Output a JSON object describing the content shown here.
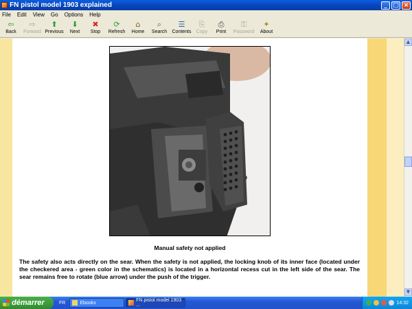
{
  "window": {
    "title": "FN pistol model 1903 explained"
  },
  "menu": [
    "File",
    "Edit",
    "View",
    "Go",
    "Options",
    "Help"
  ],
  "toolbar": [
    {
      "label": "Back",
      "icon": "back-arrow-icon",
      "glyph": "⇦",
      "color": "#2E9B2E",
      "enabled": true,
      "width": 28
    },
    {
      "label": "Forward",
      "icon": "forward-arrow-icon",
      "glyph": "⇨",
      "color": "#A8A69A",
      "enabled": false,
      "width": 34
    },
    {
      "label": "Previous",
      "icon": "up-arrow-icon",
      "glyph": "⬆",
      "color": "#2E9B2E",
      "enabled": true,
      "width": 30
    },
    {
      "label": "Next",
      "icon": "down-arrow-icon",
      "glyph": "⬇",
      "color": "#2E9B2E",
      "enabled": true,
      "width": 30
    },
    {
      "label": "Stop",
      "icon": "stop-icon",
      "glyph": "✖",
      "color": "#D42A1E",
      "enabled": true,
      "width": 30
    },
    {
      "label": "Refresh",
      "icon": "refresh-icon",
      "glyph": "⟳",
      "color": "#2E9B2E",
      "enabled": true,
      "width": 32
    },
    {
      "label": "Home",
      "icon": "home-icon",
      "glyph": "⌂",
      "color": "#8A5A22",
      "enabled": true,
      "width": 30
    },
    {
      "label": "Search",
      "icon": "search-icon",
      "glyph": "⌕",
      "color": "#555555",
      "enabled": true,
      "width": 32
    },
    {
      "label": "Contents",
      "icon": "contents-icon",
      "glyph": "☰",
      "color": "#2C5DAE",
      "enabled": true,
      "width": 33
    },
    {
      "label": "Copy",
      "icon": "copy-icon",
      "glyph": "⎘",
      "color": "#A8A69A",
      "enabled": false,
      "width": 26
    },
    {
      "label": "Print",
      "icon": "print-icon",
      "glyph": "⎙",
      "color": "#444444",
      "enabled": true,
      "width": 30
    },
    {
      "label": "Password",
      "icon": "key-icon",
      "glyph": "⚿",
      "color": "#A8A69A",
      "enabled": false,
      "width": 36
    },
    {
      "label": "About",
      "icon": "about-icon",
      "glyph": "✦",
      "color": "#B08A2A",
      "enabled": true,
      "width": 30
    }
  ],
  "content": {
    "caption": "Manual safety not applied",
    "paragraph": "The safety also acts directly on the sear. When the safety is not applied, the locking knob of its inner face (located under the checkered area - green color in the schematics) is located in a horizontal recess cut in the left side of the sear. The sear remains free to rotate (blue arrow) under the push of the trigger."
  },
  "taskbar": {
    "start_label": "démarrer",
    "language": "FR",
    "buttons": [
      {
        "label": "Ebooks",
        "icon": "folder-icon",
        "active": false
      },
      {
        "label": "FN pistol model 1903 ...",
        "icon": "ebook-app-icon",
        "active": true
      }
    ],
    "clock": "14:32"
  },
  "colors": {
    "page_bg": "#FCF0C5",
    "margin_right": "#F7D776",
    "titlebar": "#0A5FE0",
    "taskbar": "#2457D4"
  }
}
